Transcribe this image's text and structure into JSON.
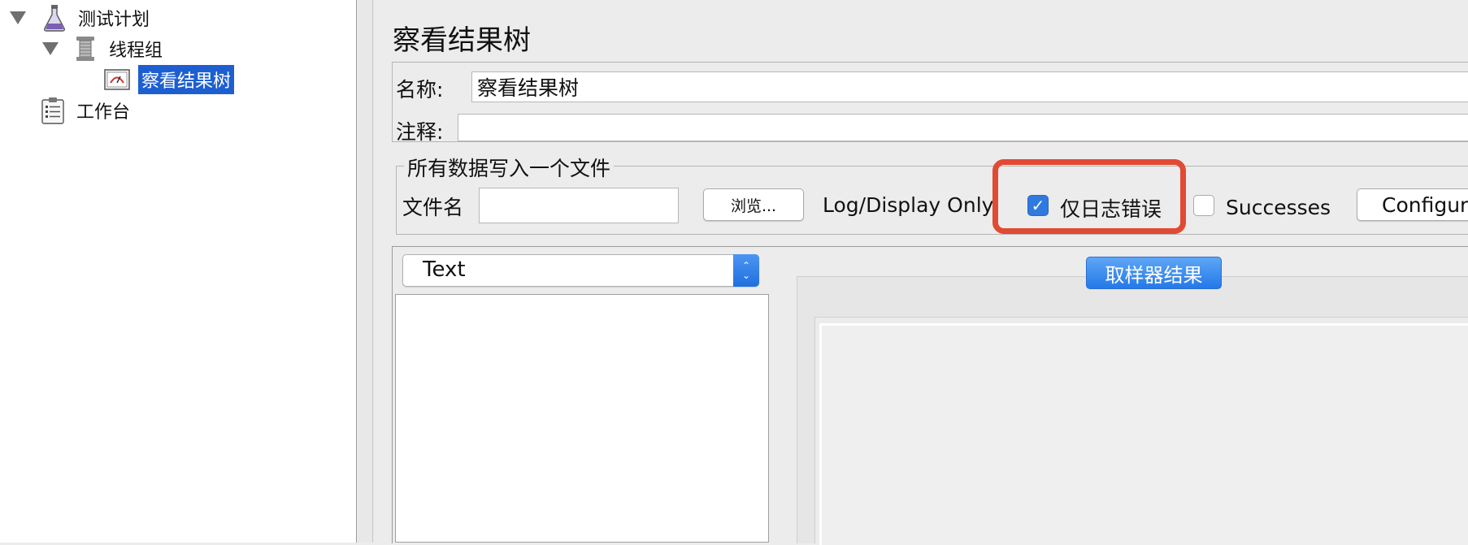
{
  "tree": {
    "items": [
      {
        "label": "测试计划",
        "icon": "test-plan-flask-icon",
        "expanded": true
      },
      {
        "label": "线程组",
        "icon": "thread-group-spool-icon",
        "expanded": true
      },
      {
        "label": "察看结果树",
        "icon": "view-results-tree-icon",
        "selected": true
      },
      {
        "label": "工作台",
        "icon": "workbench-clipboard-icon"
      }
    ]
  },
  "panel": {
    "title": "察看结果树",
    "name_label": "名称:",
    "name_value": "察看结果树",
    "comment_label": "注释:",
    "comment_value": ""
  },
  "file_section": {
    "title": "所有数据写入一个文件",
    "filename_label": "文件名",
    "filename_value": "",
    "browse_label": "浏览...",
    "log_display_label": "Log/Display Only:",
    "errors_only_label": "仅日志错误",
    "errors_only_checked": true,
    "successes_label": "Successes",
    "successes_checked": false,
    "configure_label": "Configure"
  },
  "renderer": {
    "selected": "Text"
  },
  "tabs": {
    "active": "取样器结果"
  },
  "colors": {
    "highlight": "#e14a33",
    "selection": "#1d5fd1",
    "accent": "#2479e9"
  }
}
